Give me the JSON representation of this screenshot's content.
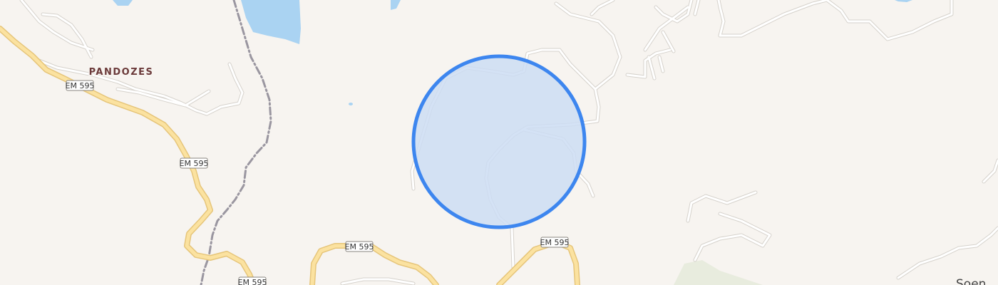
{
  "map": {
    "colors": {
      "background": "#f7f4f0",
      "water": "#aad3f2",
      "road_major_fill": "#fbe2a0",
      "road_major_casing": "#e6c57a",
      "road_minor_fill": "#ffffff",
      "road_minor_casing": "#d6d2cc",
      "railway": "#9a96a0",
      "park": "#e8ecde",
      "radius_fill": "#cdddf3",
      "radius_stroke": "#3d86ef",
      "place_label": "#6b3a3a"
    },
    "places": [
      {
        "name": "PANDOZES"
      }
    ],
    "towns": [
      {
        "name": "Soen"
      }
    ],
    "road_shields": [
      {
        "ref": "EM 595"
      },
      {
        "ref": "EM 595"
      },
      {
        "ref": "EM 595"
      },
      {
        "ref": "EM 595"
      },
      {
        "ref": "EM 595"
      }
    ]
  }
}
